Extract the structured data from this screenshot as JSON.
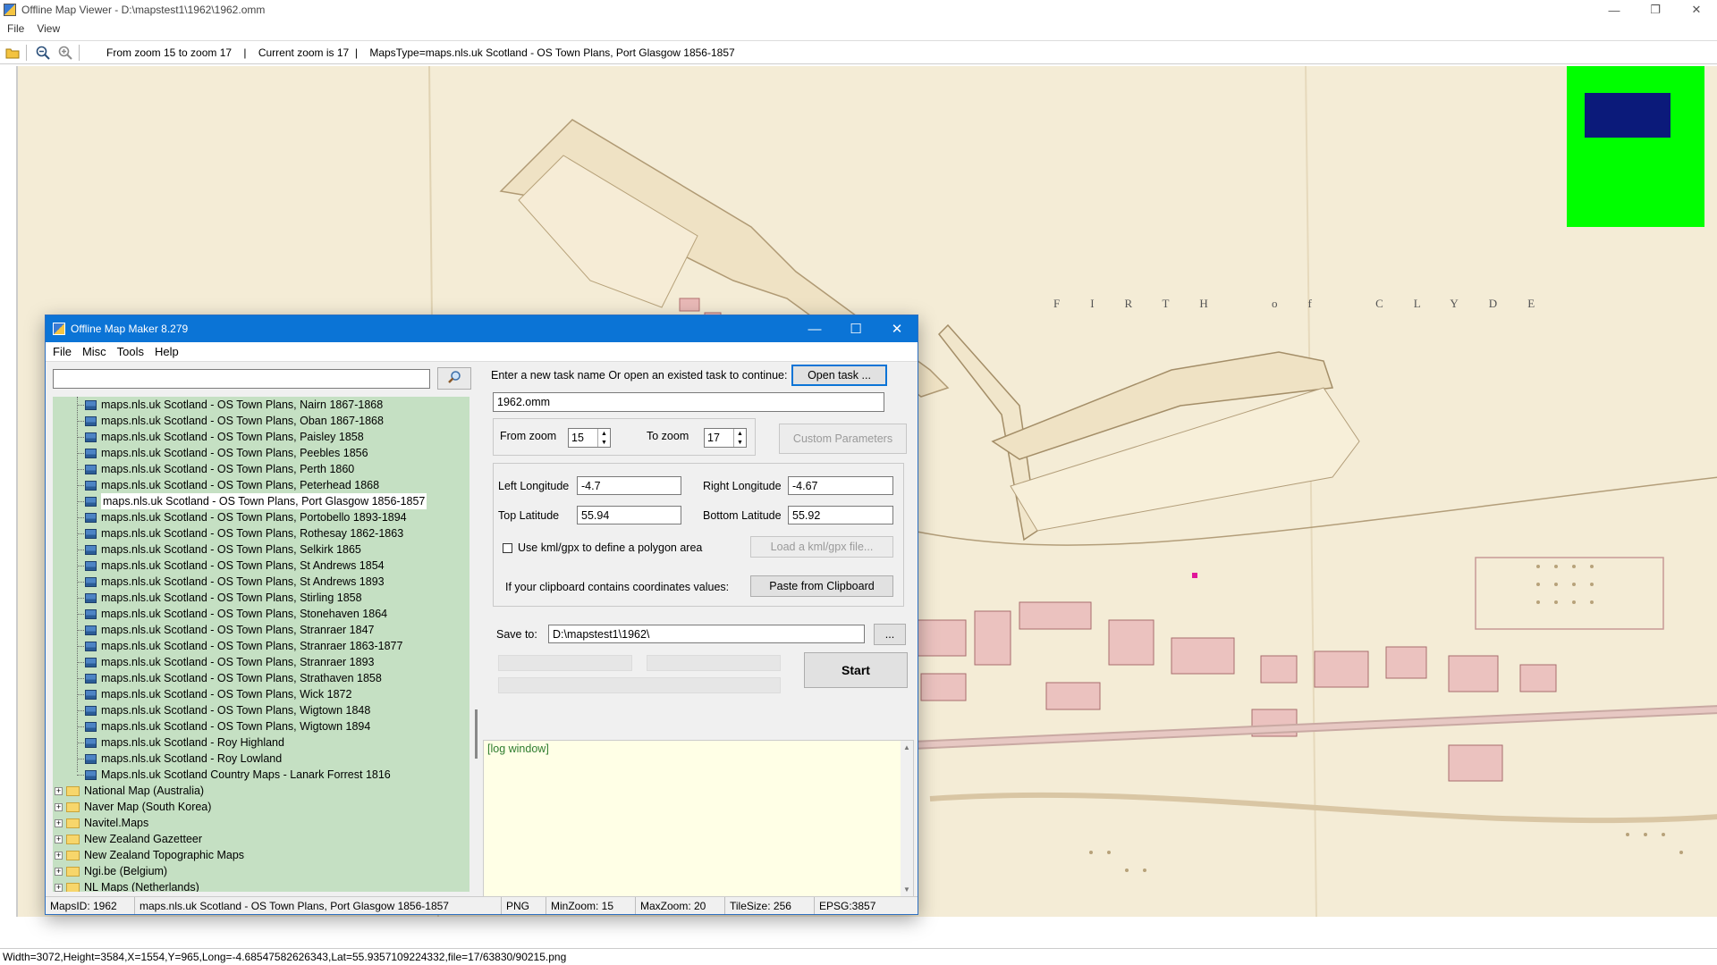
{
  "viewer": {
    "title": "Offline Map Viewer - D:\\mapstest1\\1962\\1962.omm",
    "menu": [
      "File",
      "View"
    ],
    "toolbar_info": "From zoom 15 to zoom 17    |    Current zoom is 17  |    MapsType=maps.nls.uk Scotland - OS Town Plans, Port Glasgow 1856-1857",
    "map_label": "FIRTH of CLYDE",
    "status": "Width=3072,Height=3584,X=1554,Y=965,Long=-4.68547582626343,Lat=55.9357109224332,file=17/63830/90215.png"
  },
  "dialog": {
    "title": "Offline Map Maker 8.279",
    "menu": [
      "File",
      "Misc",
      "Tools",
      "Help"
    ],
    "search": {
      "value": "",
      "placeholder": ""
    },
    "tree_children": [
      "maps.nls.uk Scotland - OS Town Plans, Nairn 1867-1868",
      "maps.nls.uk Scotland - OS Town Plans, Oban 1867-1868",
      "maps.nls.uk Scotland - OS Town Plans, Paisley 1858",
      "maps.nls.uk Scotland - OS Town Plans, Peebles 1856",
      "maps.nls.uk Scotland - OS Town Plans, Perth 1860",
      "maps.nls.uk Scotland - OS Town Plans, Peterhead 1868",
      "maps.nls.uk Scotland - OS Town Plans, Port Glasgow 1856-1857",
      "maps.nls.uk Scotland - OS Town Plans, Portobello 1893-1894",
      "maps.nls.uk Scotland - OS Town Plans, Rothesay 1862-1863",
      "maps.nls.uk Scotland - OS Town Plans, Selkirk 1865",
      "maps.nls.uk Scotland - OS Town Plans, St Andrews 1854",
      "maps.nls.uk Scotland - OS Town Plans, St Andrews 1893",
      "maps.nls.uk Scotland - OS Town Plans, Stirling 1858",
      "maps.nls.uk Scotland - OS Town Plans, Stonehaven 1864",
      "maps.nls.uk Scotland - OS Town Plans, Stranraer 1847",
      "maps.nls.uk Scotland - OS Town Plans, Stranraer 1863-1877",
      "maps.nls.uk Scotland - OS Town Plans, Stranraer 1893",
      "maps.nls.uk Scotland - OS Town Plans, Strathaven 1858",
      "maps.nls.uk Scotland - OS Town Plans, Wick 1872",
      "maps.nls.uk Scotland - OS Town Plans, Wigtown 1848",
      "maps.nls.uk Scotland - OS Town Plans, Wigtown 1894",
      "maps.nls.uk Scotland - Roy Highland",
      "maps.nls.uk Scotland - Roy Lowland",
      "Maps.nls.uk Scotland Country Maps - Lanark Forrest 1816"
    ],
    "selected_index": 6,
    "tree_folders": [
      "National Map (Australia)",
      "Naver Map (South Korea)",
      "Navitel.Maps",
      "New Zealand Gazetteer",
      "New Zealand Topographic Maps",
      "Ngi.be (Belgium)",
      "NL Maps (Netherlands)"
    ],
    "task_prompt": "Enter a new task name Or open an existed task to continue:",
    "open_task_label": "Open task ...",
    "task_name": "1962.omm",
    "from_zoom_label": "From zoom",
    "from_zoom": "15",
    "to_zoom_label": "To zoom",
    "to_zoom": "17",
    "custom_params_label": "Custom Parameters",
    "left_lon_label": "Left Longitude",
    "left_lon": "-4.7",
    "right_lon_label": "Right Longitude",
    "right_lon": "-4.67",
    "top_lat_label": "Top Latitude",
    "top_lat": "55.94",
    "bottom_lat_label": "Bottom Latitude",
    "bottom_lat": "55.92",
    "kml_label": "Use kml/gpx to define a polygon area",
    "load_kml_label": "Load a kml/gpx file...",
    "clipboard_prompt": "If your clipboard contains coordinates values:",
    "paste_label": "Paste from Clipboard",
    "save_to_label": "Save to:",
    "save_to": "D:\\mapstest1\\1962\\",
    "browse_label": "...",
    "start_label": "Start",
    "log_text": "[log window]",
    "status": {
      "maps_id": "MapsID: 1962",
      "maps_name": "maps.nls.uk Scotland - OS Town Plans, Port Glasgow 1856-1857",
      "format": "PNG",
      "min_zoom": "MinZoom: 15",
      "max_zoom": "MaxZoom: 20",
      "tile_size": "TileSize: 256",
      "epsg": "EPSG:3857"
    }
  },
  "colors": {
    "map_bg": "#f4ecd6",
    "overview_bg": "#00ff00",
    "overview_viewport": "#0b1a7a",
    "tree_bg": "#c5e0c3",
    "dialog_title": "#0b74d6",
    "log_bg": "#ffffe6"
  }
}
